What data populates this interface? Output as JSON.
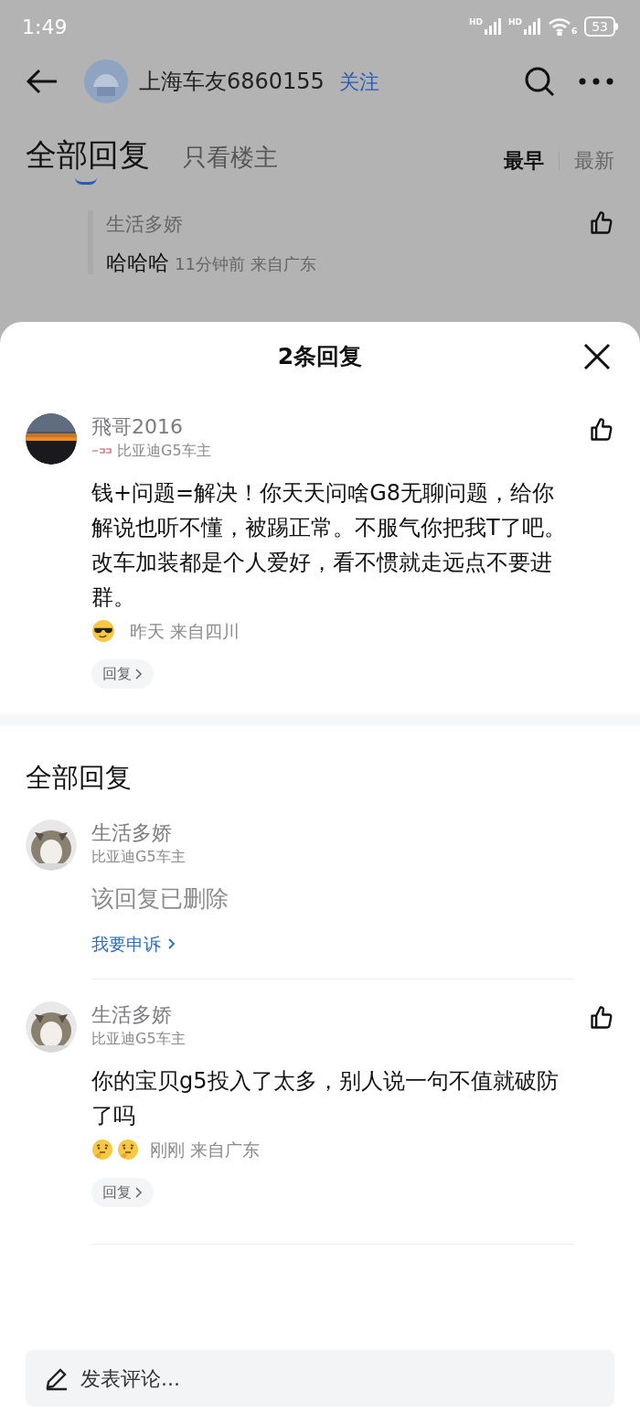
{
  "status_bar": {
    "time": "1:49",
    "signals": [
      "HD",
      "HD"
    ],
    "wifi_label": "6",
    "battery": "53"
  },
  "header": {
    "username": "上海车友6860155",
    "follow": "关注"
  },
  "tabs": [
    {
      "label": "全部回复",
      "selected": true
    },
    {
      "label": "只看楼主",
      "selected": false
    }
  ],
  "sort": [
    {
      "label": "最早",
      "selected": true
    },
    {
      "label": "最新",
      "selected": false
    }
  ],
  "background_comment": {
    "author": "生活多娇",
    "text": "哈哈哈",
    "meta": "11分钟前 来自广东"
  },
  "sheet": {
    "title": "2条回复",
    "comment": {
      "author": "飛哥2016",
      "badge": "比亚迪G5车主",
      "text": "钱+问题=解决！你天天问啥G8无聊问题，给你解说也听不懂，被踢正常。不服气你把我T了吧。改车加装都是个人爱好，看不惯就走远点不要进群。",
      "emojis": [
        {
          "kind": "cool"
        }
      ],
      "meta": "昨天 来自四川",
      "reply": "回复"
    },
    "section_title": "全部回复",
    "replies": [
      {
        "kind": "deleted",
        "author": "生活多娇",
        "badge": "比亚迪G5车主",
        "text": "该回复已删除",
        "appeal": "我要申诉"
      },
      {
        "kind": "normal",
        "author": "生活多娇",
        "badge": "比亚迪G5车主",
        "text": "你的宝贝g5投入了太多，别人说一句不值就破防了吗",
        "emojis": [
          {
            "kind": "thinking"
          },
          {
            "kind": "thinking"
          }
        ],
        "meta": "刚刚 来自广东",
        "reply": "回复"
      }
    ],
    "input": {
      "placeholder": "发表评论..."
    }
  }
}
